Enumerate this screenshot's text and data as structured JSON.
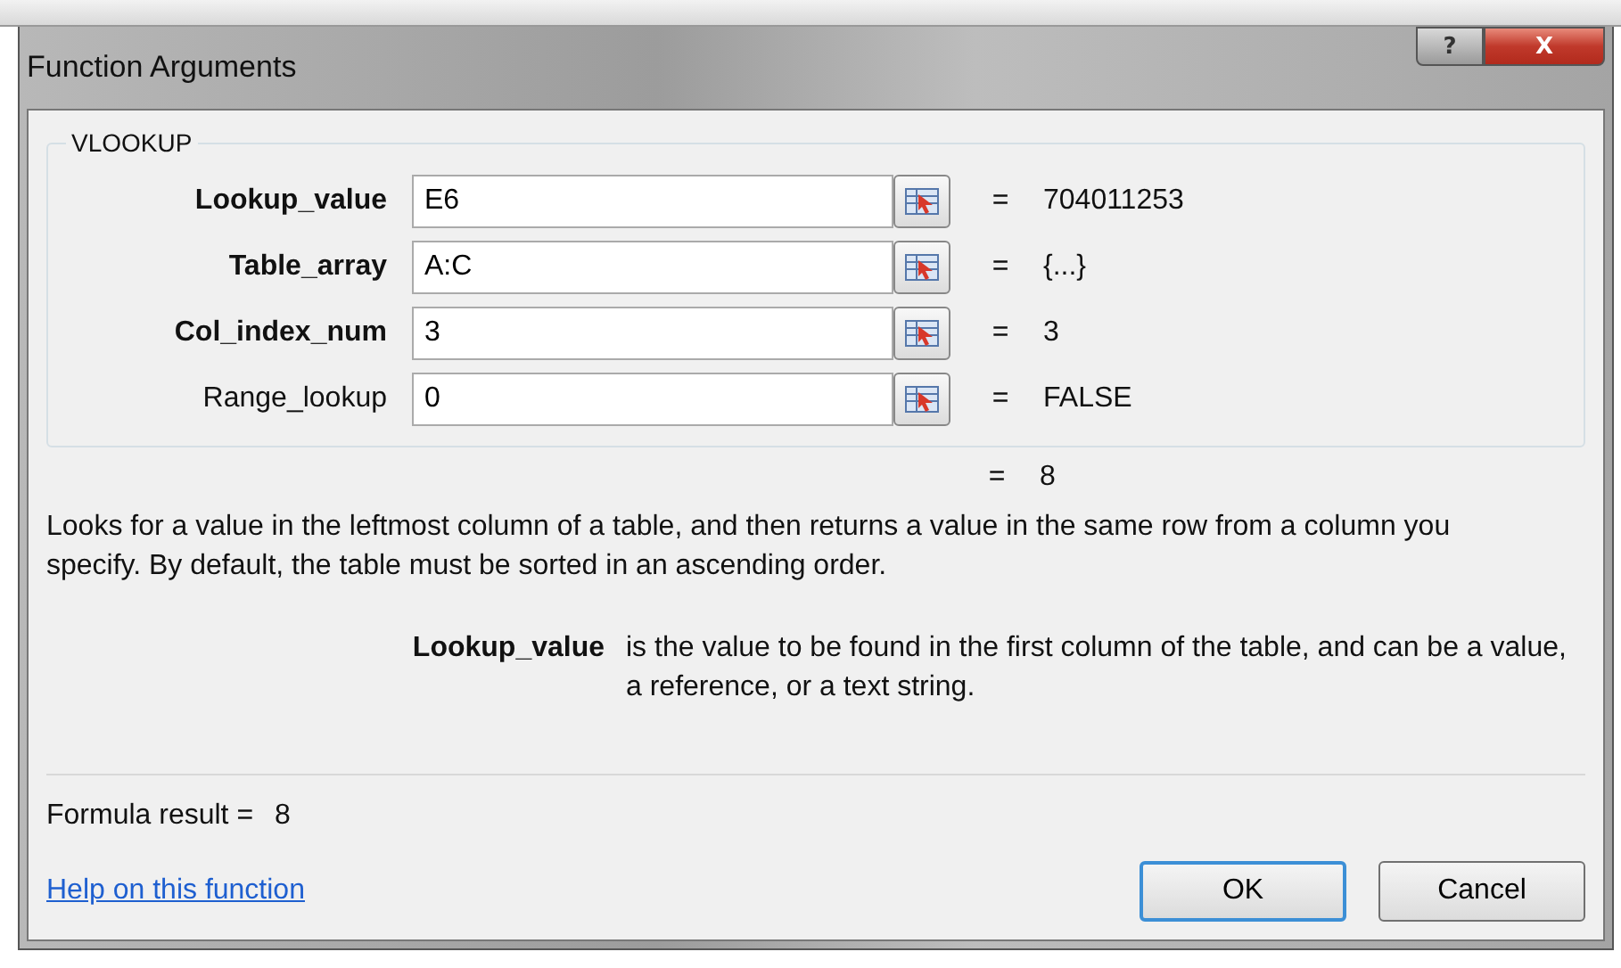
{
  "window": {
    "title": "Function Arguments",
    "help_button": "?",
    "close_button": "X"
  },
  "function_name": "VLOOKUP",
  "arguments": [
    {
      "label": "Lookup_value",
      "required": true,
      "value": "E6",
      "equals": "=",
      "result": "704011253"
    },
    {
      "label": "Table_array",
      "required": true,
      "value": "A:C",
      "equals": "=",
      "result": "{...}"
    },
    {
      "label": "Col_index_num",
      "required": true,
      "value": "3",
      "equals": "=",
      "result": "3"
    },
    {
      "label": "Range_lookup",
      "required": false,
      "value": "0",
      "equals": "=",
      "result": "FALSE"
    }
  ],
  "result_line": {
    "equals": "=",
    "value": "8"
  },
  "description": "Looks for a value in the leftmost column of a table, and then returns a value in the same row from a column you specify. By default, the table must be sorted in an ascending order.",
  "argument_help": {
    "name": "Lookup_value",
    "text": "is the value to be found in the first column of the table, and can be a value, a reference, or a text string."
  },
  "formula_result": {
    "label": "Formula result =",
    "value": "8"
  },
  "help_link": "Help on this function",
  "buttons": [
    {
      "label": "OK",
      "default": true
    },
    {
      "label": "Cancel",
      "default": false
    }
  ]
}
